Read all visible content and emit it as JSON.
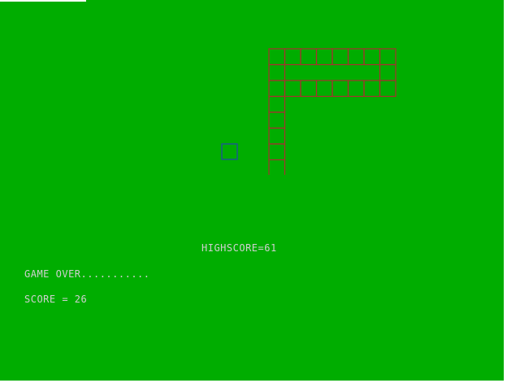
{
  "hud": {
    "highscore_text": "HIGHSCORE=61",
    "game_over_text": "GAME OVER...........",
    "score_text": "SCORE = 26"
  },
  "game": {
    "highscore": 61,
    "score": 26,
    "state": "game over",
    "snake_segment_count": 21,
    "food_count": 1
  },
  "colors": {
    "background": "#00ad00",
    "snake_outline": "#a83030",
    "food_outline": "#1f4fa0",
    "text": "#d0d0d0"
  }
}
